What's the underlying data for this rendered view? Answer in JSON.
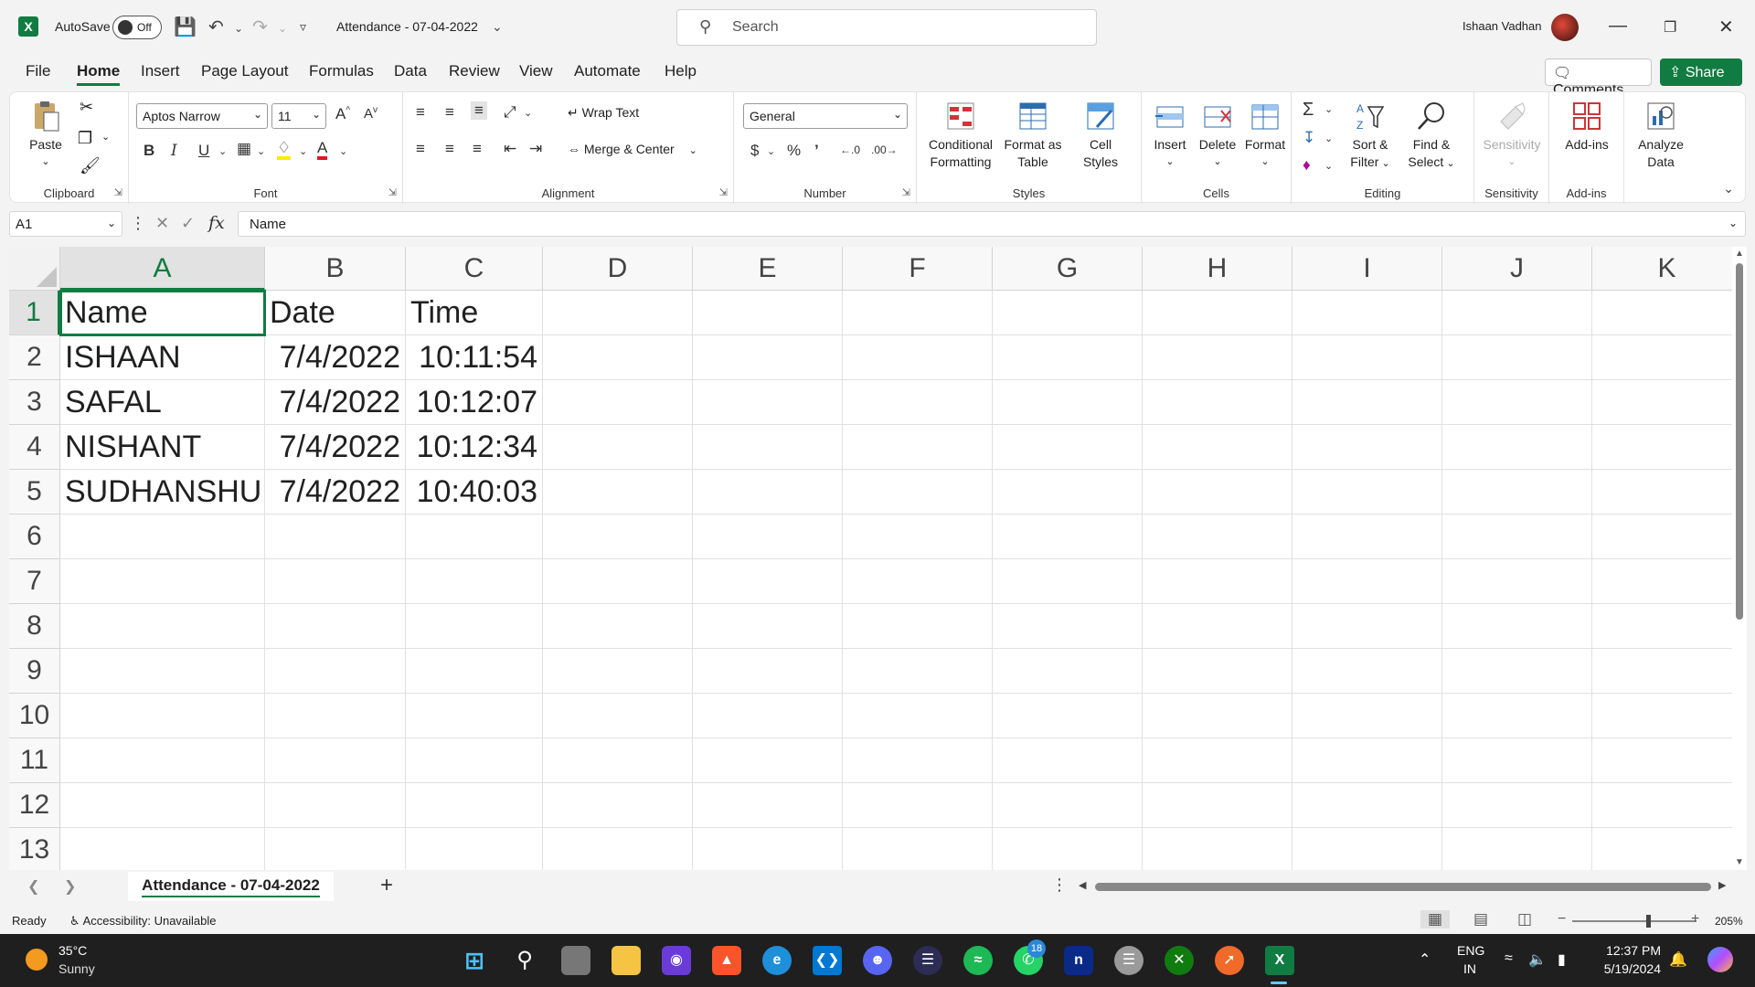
{
  "titlebar": {
    "autosave_label": "AutoSave",
    "autosave_state": "Off",
    "doc_title": "Attendance - 07-04-2022",
    "search_placeholder": "Search",
    "user_name": "Ishaan Vadhan"
  },
  "tabs": {
    "items": [
      "File",
      "Home",
      "Insert",
      "Page Layout",
      "Formulas",
      "Data",
      "Review",
      "View",
      "Automate",
      "Help"
    ],
    "active": "Home",
    "comments_label": "Comments",
    "share_label": "Share"
  },
  "ribbon": {
    "clipboard": {
      "label": "Clipboard",
      "paste": "Paste"
    },
    "font": {
      "label": "Font",
      "font_name": "Aptos Narrow",
      "font_size": "11"
    },
    "alignment": {
      "label": "Alignment",
      "wrap_text": "Wrap Text",
      "merge_center": "Merge & Center"
    },
    "number": {
      "label": "Number",
      "format": "General"
    },
    "styles": {
      "label": "Styles",
      "conditional_1": "Conditional",
      "conditional_2": "Formatting",
      "format_table_1": "Format as",
      "format_table_2": "Table",
      "cell_styles_1": "Cell",
      "cell_styles_2": "Styles"
    },
    "cells": {
      "label": "Cells",
      "insert": "Insert",
      "delete": "Delete",
      "format": "Format"
    },
    "editing": {
      "label": "Editing",
      "sort_1": "Sort &",
      "sort_2": "Filter",
      "find_1": "Find &",
      "find_2": "Select"
    },
    "sensitivity": {
      "label": "Sensitivity",
      "btn": "Sensitivity"
    },
    "addins": {
      "label": "Add-ins",
      "btn": "Add-ins"
    },
    "analyze": {
      "btn_1": "Analyze",
      "btn_2": "Data"
    }
  },
  "formula_bar": {
    "name_box": "A1",
    "fx": "fx",
    "content": "Name"
  },
  "grid": {
    "columns": [
      "A",
      "B",
      "C",
      "D",
      "E",
      "F",
      "G",
      "H",
      "I",
      "J",
      "K"
    ],
    "rows": [
      "1",
      "2",
      "3",
      "4",
      "5",
      "6",
      "7",
      "8",
      "9",
      "10",
      "11",
      "12",
      "13"
    ],
    "data": [
      [
        "Name",
        "Date",
        "Time"
      ],
      [
        "ISHAAN",
        "7/4/2022",
        "10:11:54"
      ],
      [
        "SAFAL",
        "7/4/2022",
        "10:12:07"
      ],
      [
        "NISHANT",
        "7/4/2022",
        "10:12:34"
      ],
      [
        "SUDHANSHU",
        "7/4/2022",
        "10:40:03"
      ]
    ],
    "active_cell": "A1"
  },
  "sheets": {
    "active_tab": "Attendance - 07-04-2022",
    "add_label": "+"
  },
  "statusbar": {
    "ready": "Ready",
    "accessibility": "Accessibility: Unavailable",
    "zoom": "205%"
  },
  "taskbar": {
    "temperature": "35°C",
    "condition": "Sunny",
    "whatsapp_badge": "18",
    "lang_1": "ENG",
    "lang_2": "IN",
    "time": "12:37 PM",
    "date": "5/19/2024"
  },
  "colors": {
    "accent": "#107c41",
    "share_bg": "#107c41"
  }
}
